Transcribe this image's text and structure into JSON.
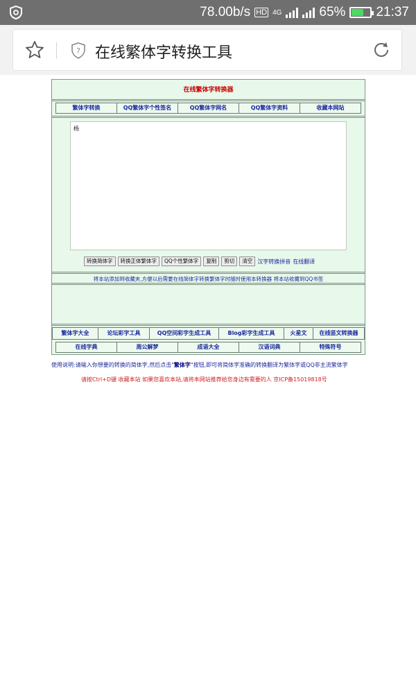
{
  "status_bar": {
    "net_speed": "78.00b/s",
    "network": "4G",
    "hd_badge": "HD",
    "battery": "65%",
    "battery_level": 0.65,
    "time": "21:37"
  },
  "browser": {
    "page_title": "在线繁体字转换工具"
  },
  "site": {
    "title": "在线繁体字转换器",
    "nav_top": [
      "繁体字转换",
      "QQ繁体字个性签名",
      "QQ繁体字网名",
      "QQ繁体字资料",
      "收藏本网站"
    ],
    "editor_text": "杨",
    "buttons": [
      "转换简体字",
      "转换正体繁体字",
      "QQ个性繁体字",
      "复制",
      "剪切",
      "清空"
    ],
    "text_links": [
      "汉字转换拼音",
      "在线翻译"
    ],
    "notice": "将本站添加到收藏夹,方便以后需要在线简体字转换繁体字时随时使用本转换器 将本站收藏到QQ书签",
    "nav_bottom_1": [
      "繁体字大全",
      "论坛彩字工具",
      "QQ空间彩字生成工具",
      "Blog彩字生成工具",
      "火星文",
      "在线竖文转换器"
    ],
    "nav_bottom_2": [
      "在线字典",
      "周公解梦",
      "成语大全",
      "汉语词典",
      "特殊符号"
    ]
  },
  "usage": {
    "before": "使用说明:请输入你想要的转换的简体字,然后点击\"",
    "bold": "繁体字",
    "after": "\"按钮,即可将简体字准确的转换翻译为繁体字或QQ非主流繁体字"
  },
  "footer": "请按Ctrl+D键 收藏本站 如果您喜欢本站,请将本网站推荐给您身边有需要的人 京ICP备15019818号"
}
